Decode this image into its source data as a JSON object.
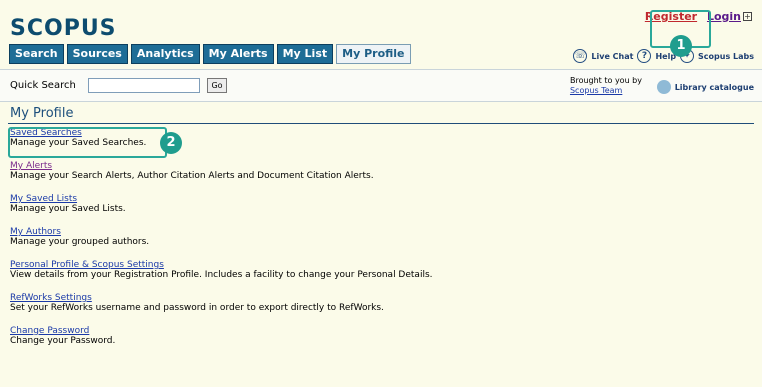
{
  "header": {
    "logo": "SCOPUS",
    "register_label": "Register",
    "login_label": "Login",
    "login_expand": "+",
    "tabs": [
      "Search",
      "Sources",
      "Analytics",
      "My Alerts",
      "My List",
      "My Profile"
    ],
    "tools": {
      "live_chat": "Live Chat",
      "help": "Help",
      "scopus_labs": "Scopus Labs"
    }
  },
  "quick_search": {
    "label": "Quick Search",
    "input_value": "",
    "go_label": "Go",
    "brought_to_you_by": "Brought to you by",
    "team_link": "Scopus Team",
    "library_catalogue": "Library catalogue"
  },
  "page": {
    "title": "My Profile",
    "items": [
      {
        "label": "Saved Searches",
        "desc": "Manage your Saved Searches."
      },
      {
        "label": "My Alerts",
        "desc": "Manage your Search Alerts, Author Citation Alerts and Document Citation Alerts."
      },
      {
        "label": "My Saved Lists",
        "desc": "Manage your Saved Lists."
      },
      {
        "label": "My Authors",
        "desc": "Manage your grouped authors."
      },
      {
        "label": "Personal Profile & Scopus Settings",
        "desc": "View details from your Registration Profile. Includes a facility to change your Personal Details."
      },
      {
        "label": "RefWorks Settings",
        "desc": "Set your RefWorks username and password in order to export directly to RefWorks."
      },
      {
        "label": "Change Password",
        "desc": "Change your Password."
      }
    ]
  },
  "annotations": {
    "badge1": "1",
    "badge2": "2"
  },
  "colors": {
    "accent": "#1e6d96",
    "highlight": "#2aa89a",
    "register": "#c0282e"
  }
}
